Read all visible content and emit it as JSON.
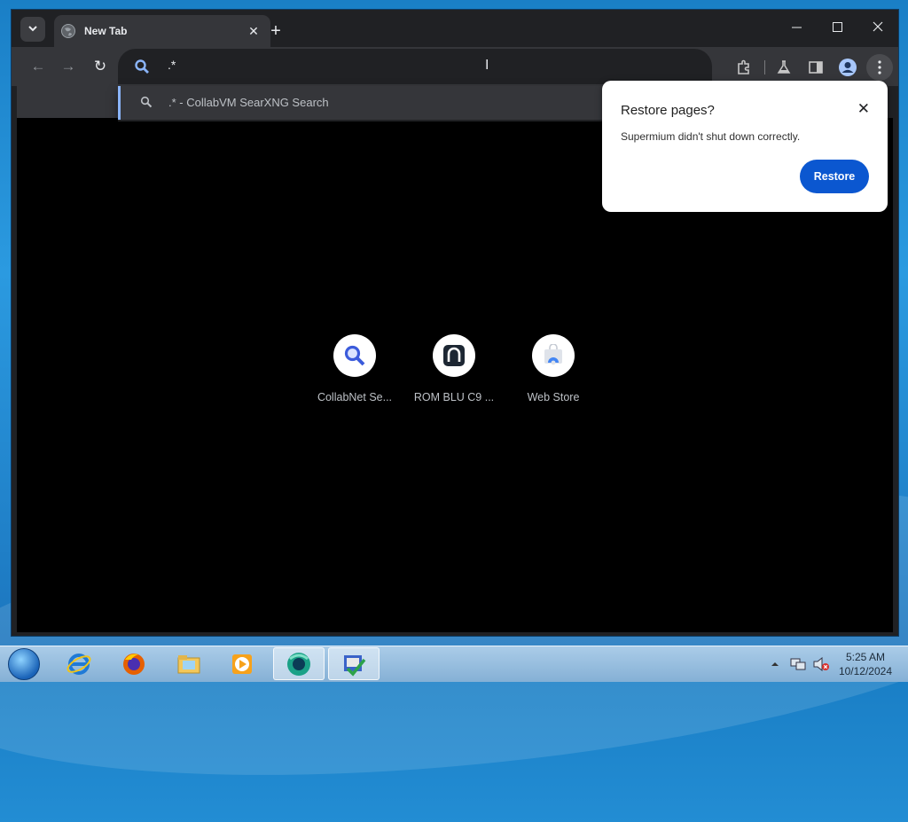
{
  "browser": {
    "tab_title": "New Tab",
    "new_tab_label": "+",
    "tab_close": "✕",
    "tab_search": "⌄",
    "window_controls": {
      "minimize": "—",
      "maximize": "☐",
      "close": "✕"
    }
  },
  "toolbar": {
    "back": "←",
    "forward": "→",
    "reload": "↻",
    "omnibox_value": ".*",
    "icons": [
      "extensions-icon",
      "labs-icon",
      "side-panel-icon",
      "profile-icon",
      "menu-icon"
    ]
  },
  "suggestion": {
    "text": ".* - CollabVM SearXNG Search"
  },
  "shortcuts": [
    {
      "label": "CollabNet Se...",
      "icon": "search-icon"
    },
    {
      "label": "ROM BLU C9 ...",
      "icon": "rom-icon"
    },
    {
      "label": "Web Store",
      "icon": "web-store-icon"
    }
  ],
  "restore_popup": {
    "title": "Restore pages?",
    "message": "Supermium didn't shut down correctly.",
    "button": "Restore",
    "close": "✕"
  },
  "taskbar": {
    "apps": [
      "internet-explorer",
      "firefox",
      "file-explorer",
      "media-player",
      "supermium",
      "app-installer"
    ],
    "clock_time": "5:25 AM",
    "clock_date": "10/12/2024"
  },
  "colors": {
    "accent": "#0b57d0",
    "toolbar": "#35363a",
    "frame": "#202124"
  }
}
